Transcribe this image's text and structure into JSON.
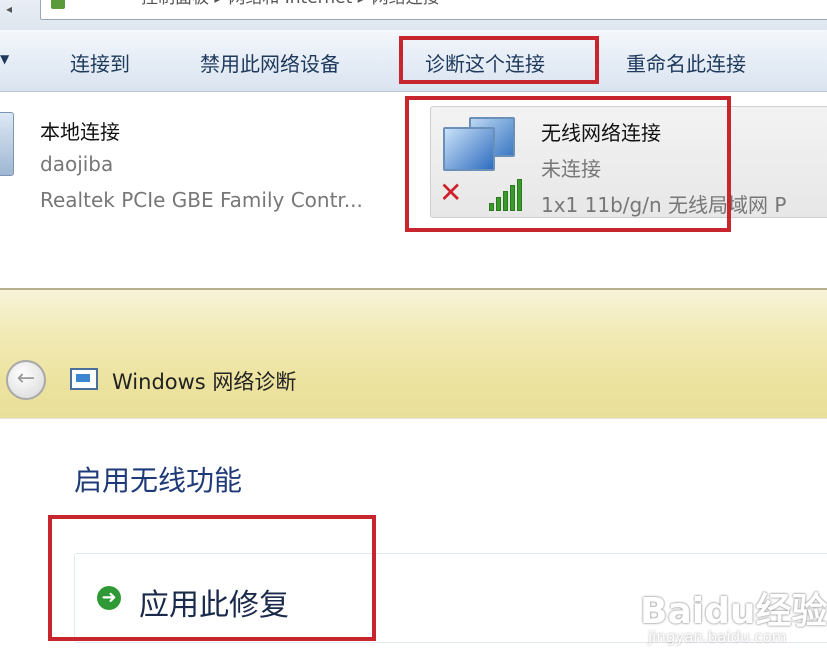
{
  "explorer": {
    "address_text": "控制面板 ▸ 网络和 Internet ▸ 网络连接",
    "command_bar": {
      "connect_to": "连接到",
      "disable_device": "禁用此网络设备",
      "diagnose": "诊断这个连接",
      "rename": "重命名此连接"
    },
    "connections": [
      {
        "name": "本地连接",
        "network": "daojiba",
        "adapter": "Realtek PCIe GBE Family Contr...",
        "icon": "lan-adapter-icon"
      },
      {
        "name": "无线网络连接",
        "status": "未连接",
        "adapter": "1x1 11b/g/n 无线局域网 P",
        "icon": "wireless-adapter-icon",
        "status_icon": "disconnected-x-icon",
        "signal_icon": "signal-bars-icon"
      }
    ]
  },
  "diagnostics": {
    "window_title": "Windows 网络诊断",
    "heading": "启用无线功能",
    "fix_option": "应用此修复"
  },
  "watermark": {
    "logo": "Baidu经验",
    "url": "jingyan.baidu.com"
  },
  "colors": {
    "highlight_box": "#c8262f",
    "link_blue": "#1f3a78",
    "fix_arrow": "#2f9a35",
    "error_x": "#d0202a"
  }
}
